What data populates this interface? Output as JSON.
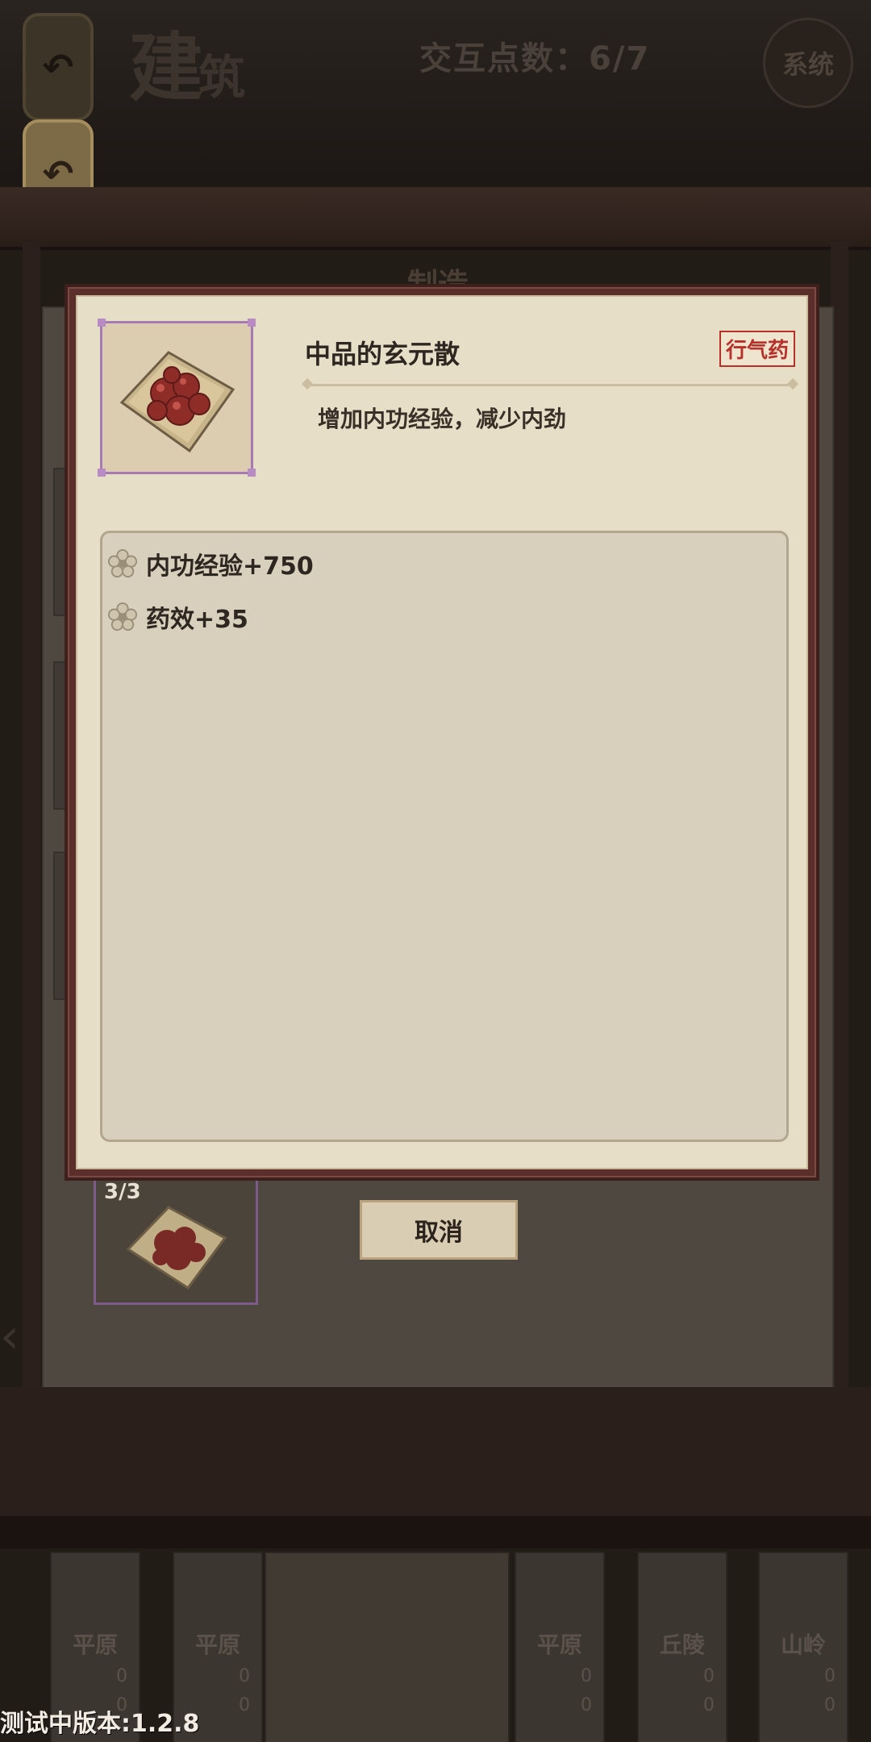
{
  "header": {
    "title_big": "建",
    "title_small": "筑",
    "interaction_points": "交互点数：6/7",
    "system_button": "系统",
    "undo_icon_glyph": "↶"
  },
  "panel": {
    "section_label": "制造"
  },
  "dialog": {
    "item_name": "中品的玄元散",
    "category": "行气药",
    "description": "增加内功经验，减少内劲",
    "effects": [
      {
        "text": "内功经验+750"
      },
      {
        "text": "药效+35"
      }
    ]
  },
  "background_item": {
    "count": "3/3"
  },
  "actions": {
    "cancel_label": "取消"
  },
  "terrain_tiles": [
    {
      "name": "平原",
      "n1": "0",
      "n2": "0"
    },
    {
      "name": "平原",
      "n1": "0",
      "n2": "0"
    },
    {
      "name": "平原",
      "n1": "0",
      "n2": "0"
    },
    {
      "name": "丘陵",
      "n1": "0",
      "n2": "0"
    },
    {
      "name": "山岭",
      "n1": "0",
      "n2": "0"
    }
  ],
  "footer": {
    "version": "测试中版本:1.2.8"
  },
  "colors": {
    "dialog_frame": "#5a2e2a",
    "parchment": "#e7dec7",
    "badge_red": "#b8302a",
    "rarity_purple": "#a67bb3"
  }
}
